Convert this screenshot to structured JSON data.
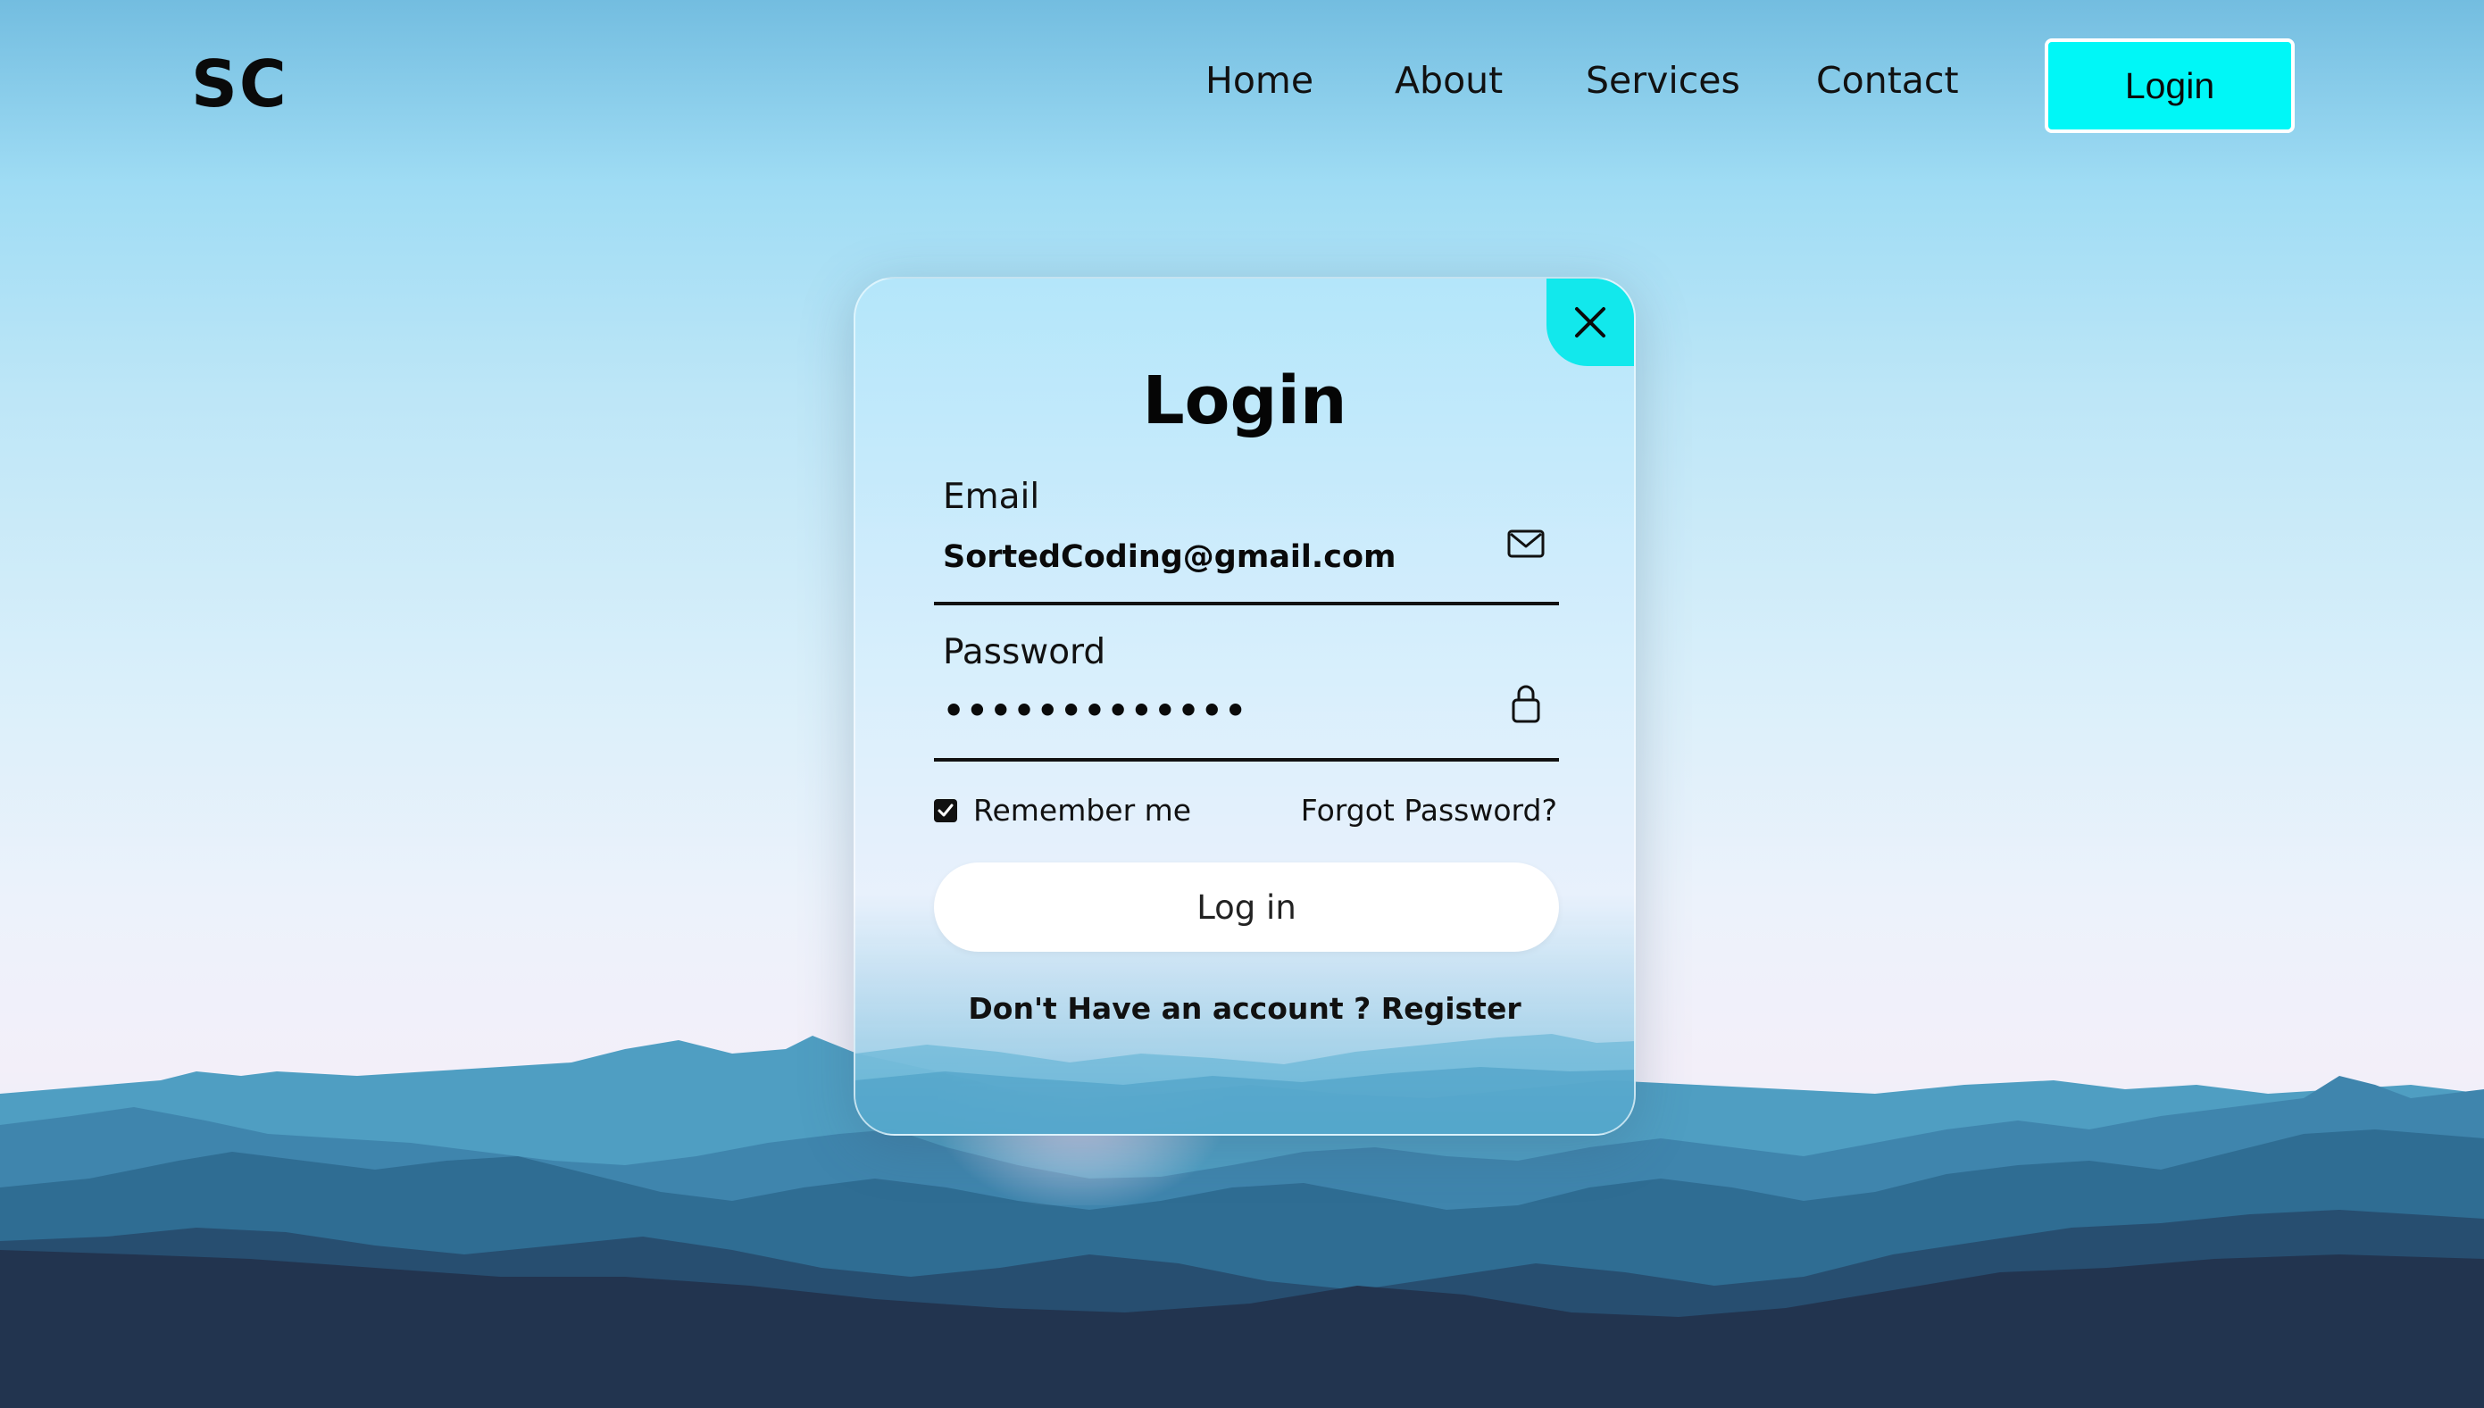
{
  "header": {
    "logo": "SC",
    "nav": [
      "Home",
      "About",
      "Services",
      "Contact"
    ],
    "login_button": "Login"
  },
  "modal": {
    "title": "Login",
    "email_label": "Email",
    "email_value": "SortedCoding@gmail.com",
    "password_label": "Password",
    "password_value": "•••••••••••••",
    "remember_label": "Remember me",
    "remember_checked": true,
    "forgot_password": "Forgot Password?",
    "submit_label": "Log in",
    "register_prompt": "Don't Have an account ?",
    "register_link": "Register"
  },
  "colors": {
    "accent": "#00f7f7",
    "close_button": "#12e8ec",
    "text": "#0a0a0a",
    "sky_top": "#73bde0",
    "mountain_far": "#4f9ec2",
    "mountain_mid": "#2f6d93",
    "mountain_dark": "#22344f"
  },
  "icons": {
    "close": "close-icon",
    "email": "envelope-icon",
    "password": "lock-icon",
    "checkbox": "checkmark-icon"
  }
}
